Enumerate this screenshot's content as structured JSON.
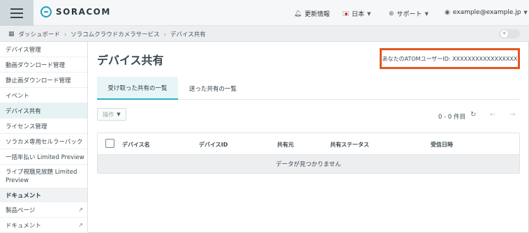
{
  "header": {
    "logo_text": "SORACOM",
    "news_label": "更新情報",
    "language_label": "日本",
    "support_label": "サポート",
    "user_label": "example@example.jp"
  },
  "breadcrumb": {
    "items": [
      "ダッシュボード",
      "ソラコムクラウドカメラサービス",
      "デバイス共有"
    ]
  },
  "sidebar": {
    "items": [
      {
        "label": "デバイス管理"
      },
      {
        "label": "動画ダウンロード管理"
      },
      {
        "label": "静止画ダウンロード管理"
      },
      {
        "label": "イベント"
      },
      {
        "label": "デバイス共有",
        "active": true
      },
      {
        "label": "ライセンス管理"
      },
      {
        "label": "ソラカメ専用セルラーパック"
      },
      {
        "label": "一括年払い Limited Preview"
      },
      {
        "label": "ライブ視聴見放題 Limited Preview"
      }
    ],
    "section_label": "ドキュメント",
    "doc_items": [
      {
        "label": "製品ページ"
      },
      {
        "label": "ドキュメント"
      }
    ]
  },
  "main": {
    "title": "デバイス共有",
    "atom_user_id": "あなたのATOMユーザーID: XXXXXXXXXXXXXXXXX",
    "tabs": [
      "受け取った共有の一覧",
      "送った共有の一覧"
    ],
    "operation_label": "操作",
    "pager_text": "0 - 0 件目",
    "table": {
      "columns": [
        "デバイス名",
        "デバイスID",
        "共有元",
        "共有ステータス",
        "受信日時"
      ],
      "empty_message": "データが見つかりません"
    }
  },
  "colors": {
    "accent": "#29b0c1",
    "highlight_border": "#e2561f"
  }
}
